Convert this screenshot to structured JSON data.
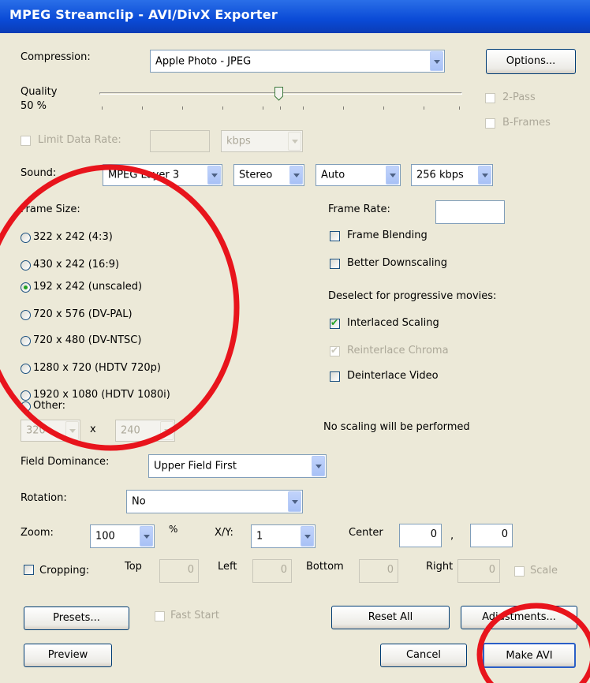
{
  "window": {
    "title": "MPEG Streamclip - AVI/DivX Exporter"
  },
  "compression": {
    "label": "Compression:",
    "value": "Apple Photo - JPEG",
    "options_button": "Options..."
  },
  "quality": {
    "label": "Quality",
    "value_text": "50 %",
    "level": 0.5,
    "two_pass": "2-Pass",
    "b_frames": "B-Frames"
  },
  "data_rate": {
    "label": "Limit Data Rate:",
    "value": "",
    "unit": "kbps"
  },
  "sound": {
    "label": "Sound:",
    "codec": "MPEG Layer 3",
    "channels": "Stereo",
    "rate": "Auto",
    "bitrate": "256 kbps"
  },
  "frame_size": {
    "label": "Frame Size:",
    "options": [
      {
        "label": "322 x 242  (4:3)",
        "selected": false
      },
      {
        "label": "430 x 242  (16:9)",
        "selected": false
      },
      {
        "label": "192 x 242  (unscaled)",
        "selected": true
      },
      {
        "label": "720 x 576  (DV-PAL)",
        "selected": false
      },
      {
        "label": "720 x 480  (DV-NTSC)",
        "selected": false
      },
      {
        "label": "1280 x 720  (HDTV 720p)",
        "selected": false
      },
      {
        "label": "1920 x 1080  (HDTV 1080i)",
        "selected": false
      },
      {
        "label": "Other:",
        "selected": false
      }
    ],
    "other_width": "320",
    "other_x": "x",
    "other_height": "240"
  },
  "frame_rate": {
    "label": "Frame Rate:",
    "value": ""
  },
  "options": {
    "frame_blending": "Frame Blending",
    "better_downscaling": "Better Downscaling",
    "deselect_note": "Deselect for progressive movies:",
    "interlaced_scaling": "Interlaced Scaling",
    "reinterlace_chroma": "Reinterlace Chroma",
    "deinterlace_video": "Deinterlace Video",
    "scaling_note": "No scaling will be performed"
  },
  "field_dominance": {
    "label": "Field Dominance:",
    "value": "Upper Field First"
  },
  "rotation": {
    "label": "Rotation:",
    "value": "No"
  },
  "zoom": {
    "label": "Zoom:",
    "value": "100",
    "unit": "%",
    "xy_label": "X/Y:",
    "xy_value": "1",
    "center_label": "Center",
    "center_x": "0",
    "sep": ",",
    "center_y": "0"
  },
  "cropping": {
    "label": "Cropping:",
    "top_label": "Top",
    "top": "0",
    "left_label": "Left",
    "left": "0",
    "bottom_label": "Bottom",
    "bottom": "0",
    "right_label": "Right",
    "right": "0",
    "scale": "Scale"
  },
  "buttons": {
    "presets": "Presets...",
    "fast_start": "Fast Start",
    "reset_all": "Reset All",
    "adjustments": "Adjustments...",
    "preview": "Preview",
    "cancel": "Cancel",
    "make_avi": "Make AVI"
  },
  "annotation_color": "#e8141c"
}
